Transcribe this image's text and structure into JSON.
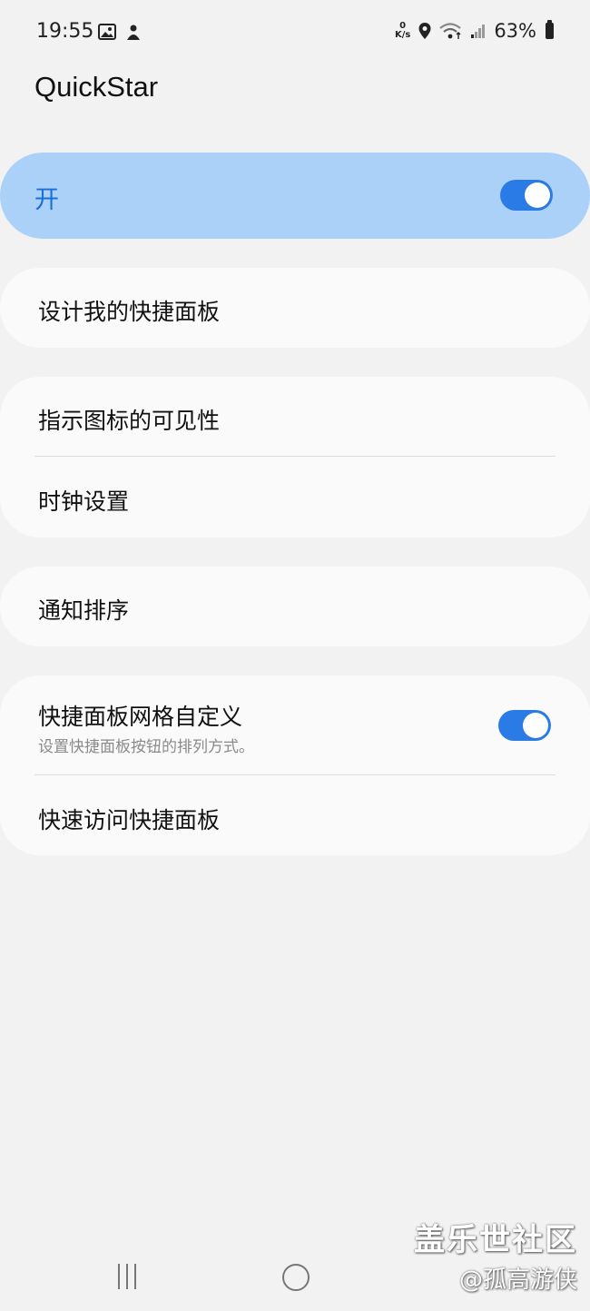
{
  "status_bar": {
    "time": "19:55",
    "speed_value": "0",
    "speed_unit": "K/s",
    "battery": "63%",
    "icons": [
      "image-icon",
      "notification-app-icon",
      "location-icon",
      "wifi-icon",
      "signal-icon",
      "battery-icon"
    ]
  },
  "app": {
    "title": "QuickStar"
  },
  "master_switch": {
    "label": "开",
    "checked": true
  },
  "sections": {
    "design": {
      "label": "设计我的快捷面板"
    },
    "indicator_icons": {
      "label": "指示图标的可见性"
    },
    "clock": {
      "label": "时钟设置"
    },
    "notification_order": {
      "label": "通知排序"
    },
    "grid_custom": {
      "label": "快捷面板网格自定义",
      "sub": "设置快捷面板按钮的排列方式。",
      "checked": true
    },
    "quick_access": {
      "label": "快速访问快捷面板"
    }
  },
  "nav": {
    "icons": [
      "recents-icon",
      "home-icon"
    ]
  },
  "watermark": {
    "title": "盖乐世社区",
    "user": "@孤高游侠"
  },
  "colors": {
    "accent": "#2a7be6",
    "master_bg": "#abd1f8",
    "card_bg": "#fafafa",
    "page_bg": "#f2f2f2"
  }
}
